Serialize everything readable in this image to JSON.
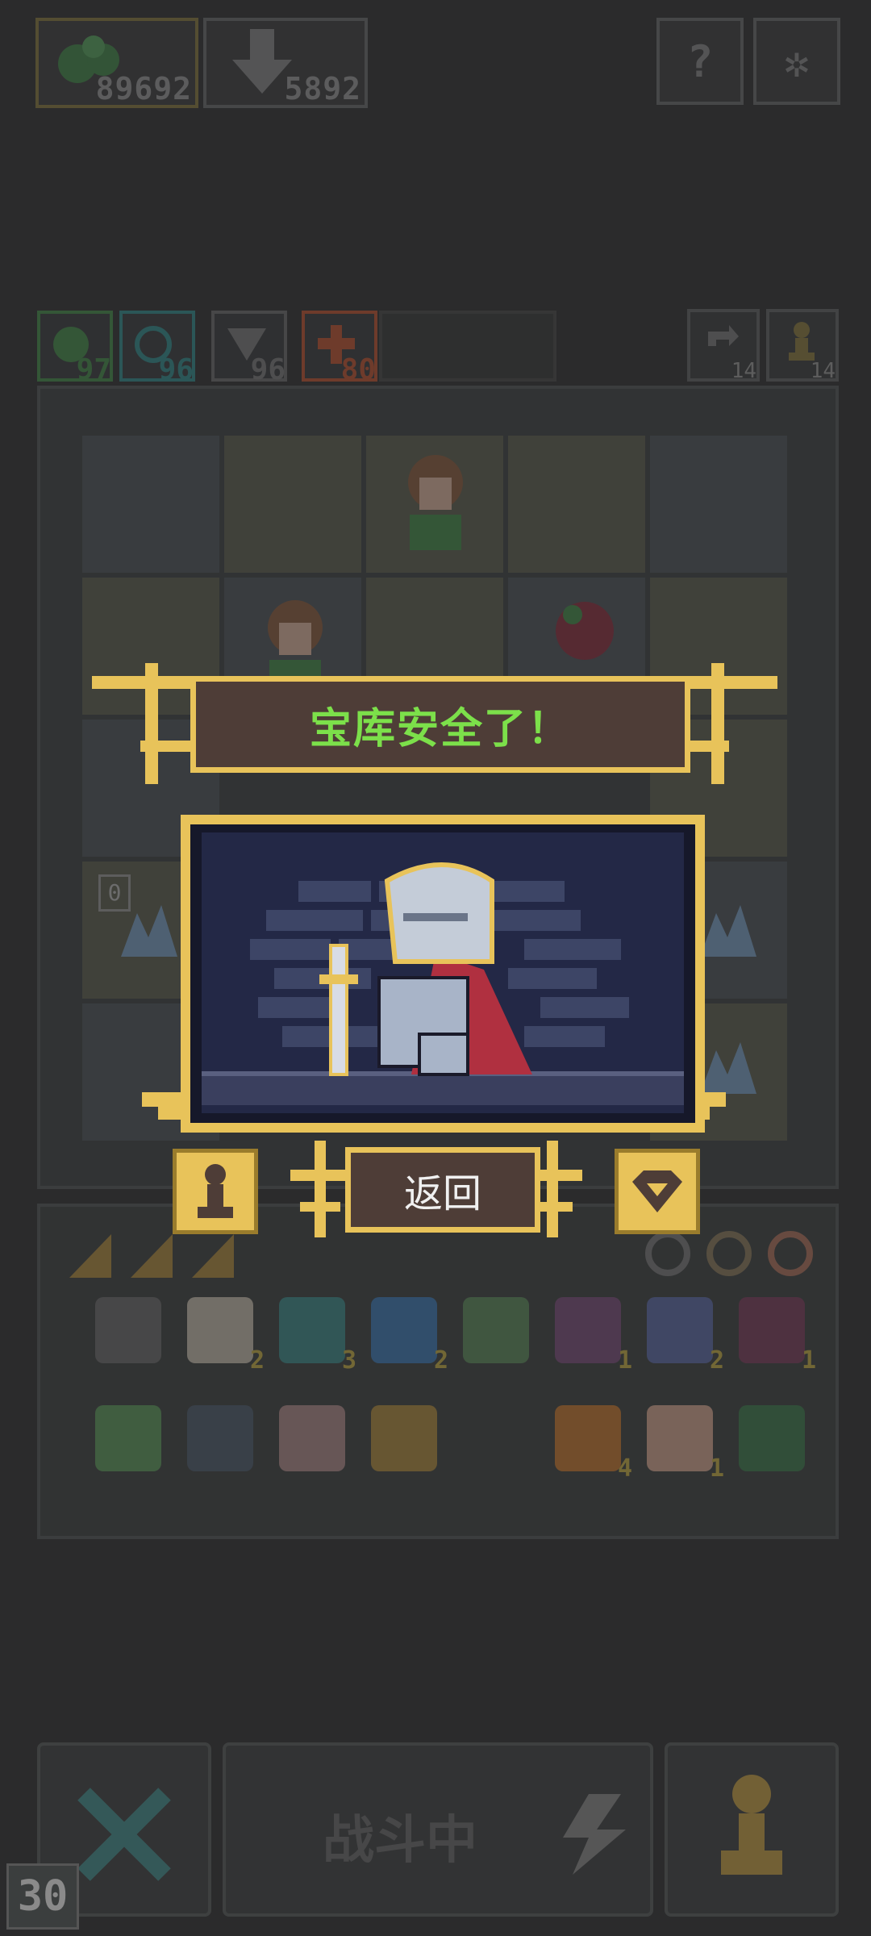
{
  "resources": [
    {
      "name": "seeds",
      "icon": "seed-icon",
      "value": "89692",
      "color": "#d4b94d"
    },
    {
      "name": "gems",
      "icon": "arrow-down-icon",
      "value": "5892",
      "color": "#8a8a8a"
    }
  ],
  "top_buttons": [
    {
      "name": "help",
      "icon": "question-icon",
      "label": "?"
    },
    {
      "name": "settings",
      "icon": "gear-icon",
      "label": "✲"
    }
  ],
  "stats": [
    {
      "name": "hp",
      "icon": "heart-icon",
      "value": "97",
      "color": "#3f8a46"
    },
    {
      "name": "magic",
      "icon": "spiral-icon",
      "value": "96",
      "color": "#2b8b8b"
    },
    {
      "name": "attack",
      "icon": "sword-icon",
      "value": "96",
      "color": "#7a7a7a"
    },
    {
      "name": "power",
      "icon": "cross-icon",
      "value": "80",
      "color": "#c0502a"
    }
  ],
  "side_stats": [
    {
      "name": "refresh",
      "icon": "refresh-icon",
      "value": "14"
    },
    {
      "name": "pawn",
      "icon": "pawn-icon",
      "value": "14"
    }
  ],
  "board": {
    "marker": "0"
  },
  "inventory": {
    "row1": [
      {
        "icon": "map-icon",
        "count": ""
      },
      {
        "icon": "scroll-icon",
        "count": "2"
      },
      {
        "icon": "heart-gem-icon",
        "count": "3"
      },
      {
        "icon": "orb-icon",
        "count": "2"
      },
      {
        "icon": "potion-icon",
        "count": ""
      },
      {
        "icon": "bat-icon",
        "count": "1"
      },
      {
        "icon": "hourglass-icon",
        "count": "2"
      },
      {
        "icon": "jar-icon",
        "count": "1"
      }
    ],
    "row2": [
      {
        "icon": "shovel-icon",
        "count": ""
      },
      {
        "icon": "chest-icon",
        "count": ""
      },
      {
        "icon": "cage-icon",
        "count": ""
      },
      {
        "icon": "trident-icon",
        "count": ""
      },
      {
        "icon": "ring-icon",
        "count": "4"
      },
      {
        "icon": "hand-icon",
        "count": "1"
      },
      {
        "icon": "basket-icon",
        "count": ""
      }
    ]
  },
  "dialog": {
    "title": "宝库安全了！",
    "back_label": "返回"
  },
  "bottom": {
    "battle_label": "战斗中",
    "turn_counter": "30"
  },
  "colors": {
    "gold": "#e8c35a",
    "banner_bg": "#4e3d37",
    "title_green": "#7ce04a",
    "background": "#2b2b2c"
  }
}
